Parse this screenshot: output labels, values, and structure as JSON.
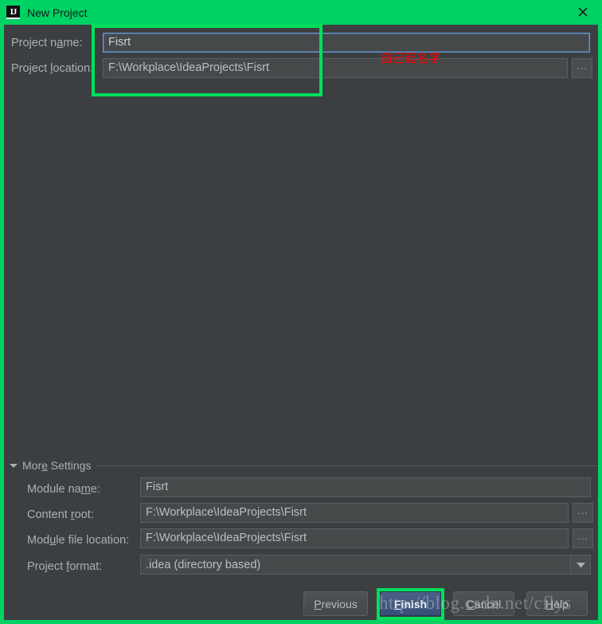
{
  "window": {
    "title": "New Project",
    "app_icon": "intellij-idea-logo-icon",
    "close_icon": "close-icon",
    "titlebar_color": "#00d264",
    "background_color": "#3c3f41"
  },
  "top_form": {
    "project_name": {
      "label_before": "Project n",
      "label_mnemonic": "a",
      "label_after": "me:",
      "value": "Fisrt",
      "focused": true
    },
    "project_location": {
      "label_before": "Project ",
      "label_mnemonic": "l",
      "label_after": "ocation:",
      "value": "F:\\Workplace\\IdeaProjects\\Fisrt",
      "browse_label": "...",
      "browse_icon": "ellipsis-icon"
    }
  },
  "annotations": {
    "red_note": "自己起名字",
    "red_color": "#ff0000",
    "highlight_color": "#00e05a"
  },
  "more_settings": {
    "label_before": "Mor",
    "label_mnemonic": "e",
    "label_after": " Settings",
    "expanded": true,
    "collapse_icon": "triangle-down-icon",
    "fields": [
      {
        "name": "module-name",
        "label_before": "Module na",
        "label_mnemonic": "m",
        "label_after": "e:",
        "value": "Fisrt",
        "has_browse": false,
        "type": "text"
      },
      {
        "name": "content-root",
        "label_before": "Content ",
        "label_mnemonic": "r",
        "label_after": "oot:",
        "value": "F:\\Workplace\\IdeaProjects\\Fisrt",
        "has_browse": true,
        "browse_label": "...",
        "type": "text"
      },
      {
        "name": "module-file-location",
        "label_before": "Mod",
        "label_mnemonic": "u",
        "label_after": "le file location:",
        "value": "F:\\Workplace\\IdeaProjects\\Fisrt",
        "has_browse": true,
        "browse_label": "...",
        "type": "text"
      },
      {
        "name": "project-format",
        "label_before": "Project ",
        "label_mnemonic": "f",
        "label_after": "ormat:",
        "value": ".idea (directory based)",
        "has_browse": false,
        "type": "combo",
        "dropdown_icon": "triangle-down-icon"
      }
    ]
  },
  "buttons": {
    "previous": {
      "label_before": "",
      "label_mnemonic": "P",
      "label_after": "revious",
      "default": false
    },
    "finish": {
      "label_before": "",
      "label_mnemonic": "F",
      "label_after": "inish",
      "default": true,
      "highlighted": true
    },
    "cancel": {
      "label_before": "",
      "label_mnemonic": "C",
      "label_after": "ancel",
      "default": false
    },
    "help": {
      "label_before": "",
      "label_mnemonic": "H",
      "label_after": "elp",
      "default": false
    }
  },
  "watermark": {
    "text": "http://blog.csdn.net/cflys"
  }
}
